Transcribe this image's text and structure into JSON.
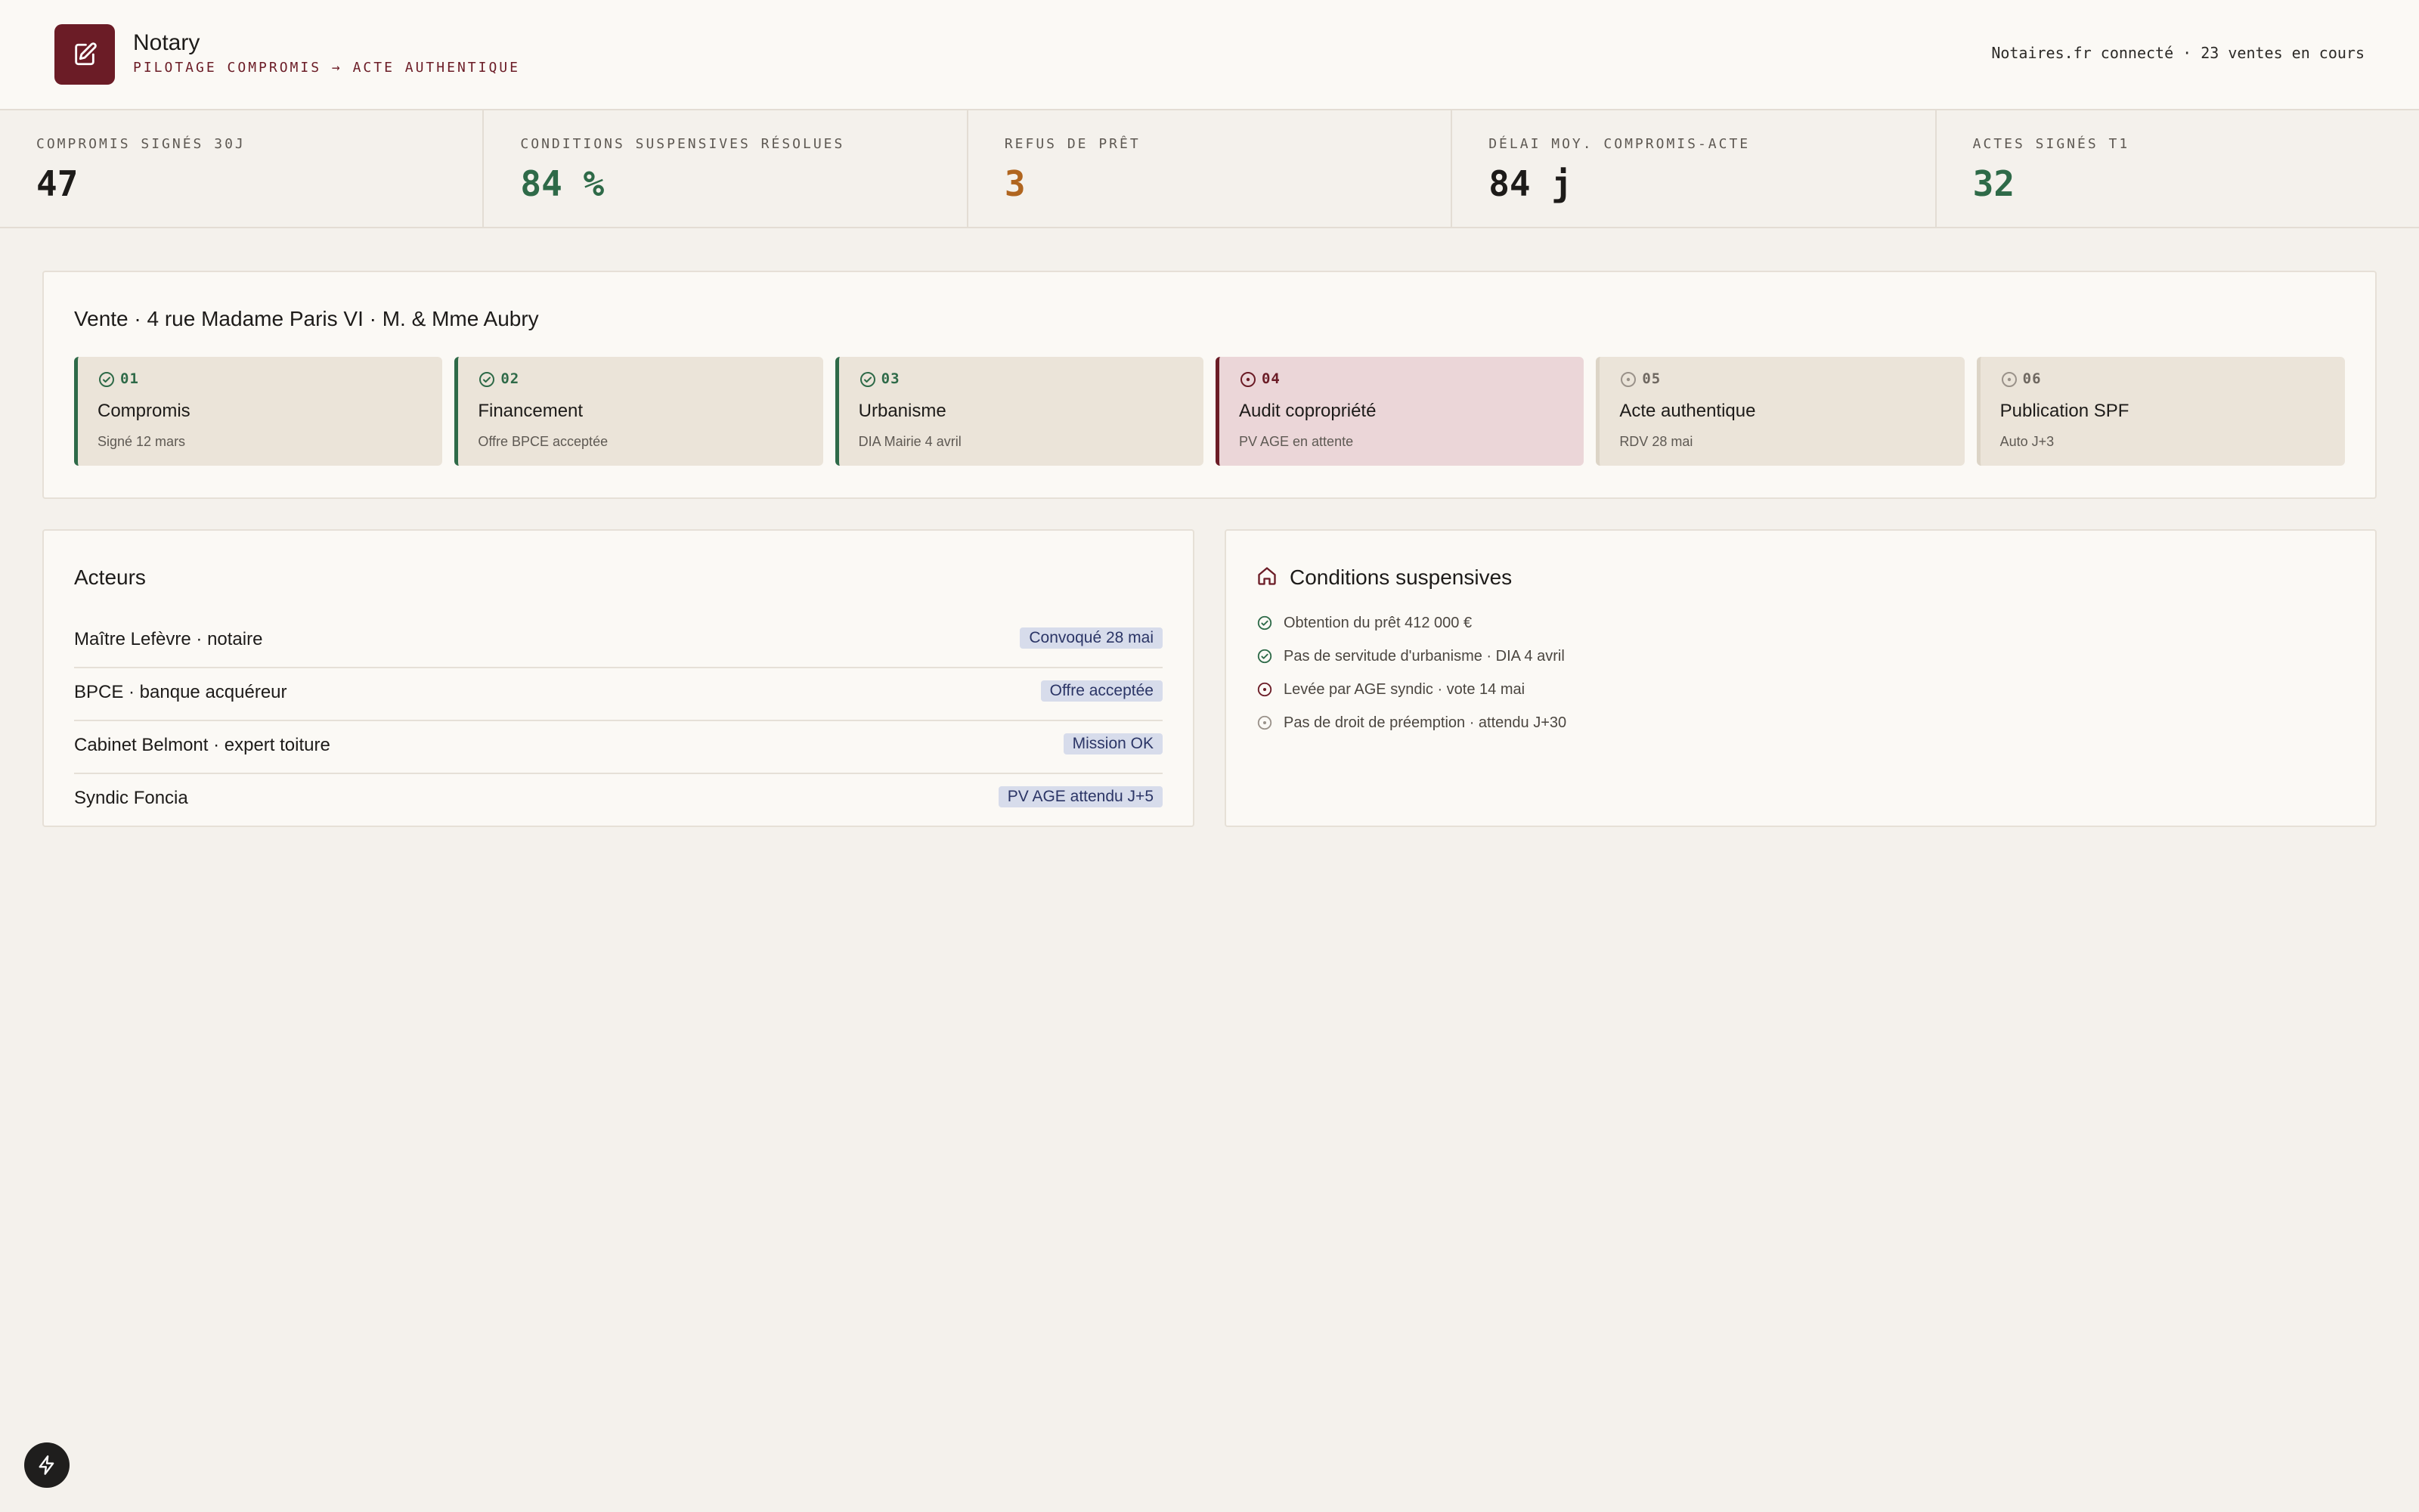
{
  "app": {
    "name": "Notary",
    "subtitle": "PILOTAGE COMPROMIS → ACTE AUTHENTIQUE",
    "status": "Notaires.fr connecté · 23 ventes en cours"
  },
  "kpis": [
    {
      "label": "COMPROMIS SIGNÉS 30J",
      "value": "47",
      "color": "#1d1b19"
    },
    {
      "label": "CONDITIONS SUSPENSIVES RÉSOLUES",
      "value": "84 %",
      "color": "#2e6a48"
    },
    {
      "label": "REFUS DE PRÊT",
      "value": "3",
      "color": "#b0651f"
    },
    {
      "label": "DÉLAI MOY. COMPROMIS-ACTE",
      "value": "84 j",
      "color": "#1d1b19"
    },
    {
      "label": "ACTES SIGNÉS T1",
      "value": "32",
      "color": "#2e6a48"
    }
  ],
  "sale": {
    "title": "Vente · 4 rue Madame Paris VI · M. & Mme Aubry",
    "steps": [
      {
        "num": "01",
        "title": "Compromis",
        "sub": "Signé 12 mars",
        "state": "done"
      },
      {
        "num": "02",
        "title": "Financement",
        "sub": "Offre BPCE acceptée",
        "state": "done"
      },
      {
        "num": "03",
        "title": "Urbanisme",
        "sub": "DIA Mairie 4 avril",
        "state": "done"
      },
      {
        "num": "04",
        "title": "Audit copropriété",
        "sub": "PV AGE en attente",
        "state": "alert"
      },
      {
        "num": "05",
        "title": "Acte authentique",
        "sub": "RDV 28 mai",
        "state": "todo"
      },
      {
        "num": "06",
        "title": "Publication SPF",
        "sub": "Auto J+3",
        "state": "todo"
      }
    ]
  },
  "actors": {
    "title": "Acteurs",
    "rows": [
      {
        "name": "Maître Lefèvre · notaire",
        "badge": "Convoqué 28 mai"
      },
      {
        "name": "BPCE · banque acquéreur",
        "badge": "Offre acceptée"
      },
      {
        "name": "Cabinet Belmont · expert toiture",
        "badge": "Mission OK"
      },
      {
        "name": "Syndic Foncia",
        "badge": "PV AGE attendu J+5"
      }
    ]
  },
  "conditions": {
    "title": "Conditions suspensives",
    "items": [
      {
        "text": "Obtention du prêt 412 000 €",
        "state": "done"
      },
      {
        "text": "Pas de servitude d'urbanisme · DIA 4 avril",
        "state": "done"
      },
      {
        "text": "Levée par AGE syndic · vote 14 mai",
        "state": "alert"
      },
      {
        "text": "Pas de droit de préemption · attendu J+30",
        "state": "pending"
      }
    ]
  },
  "colors": {
    "done": "#2e6a48",
    "alert": "#6b1c26",
    "pending": "#9a928a",
    "brand": "#6b1c26"
  }
}
